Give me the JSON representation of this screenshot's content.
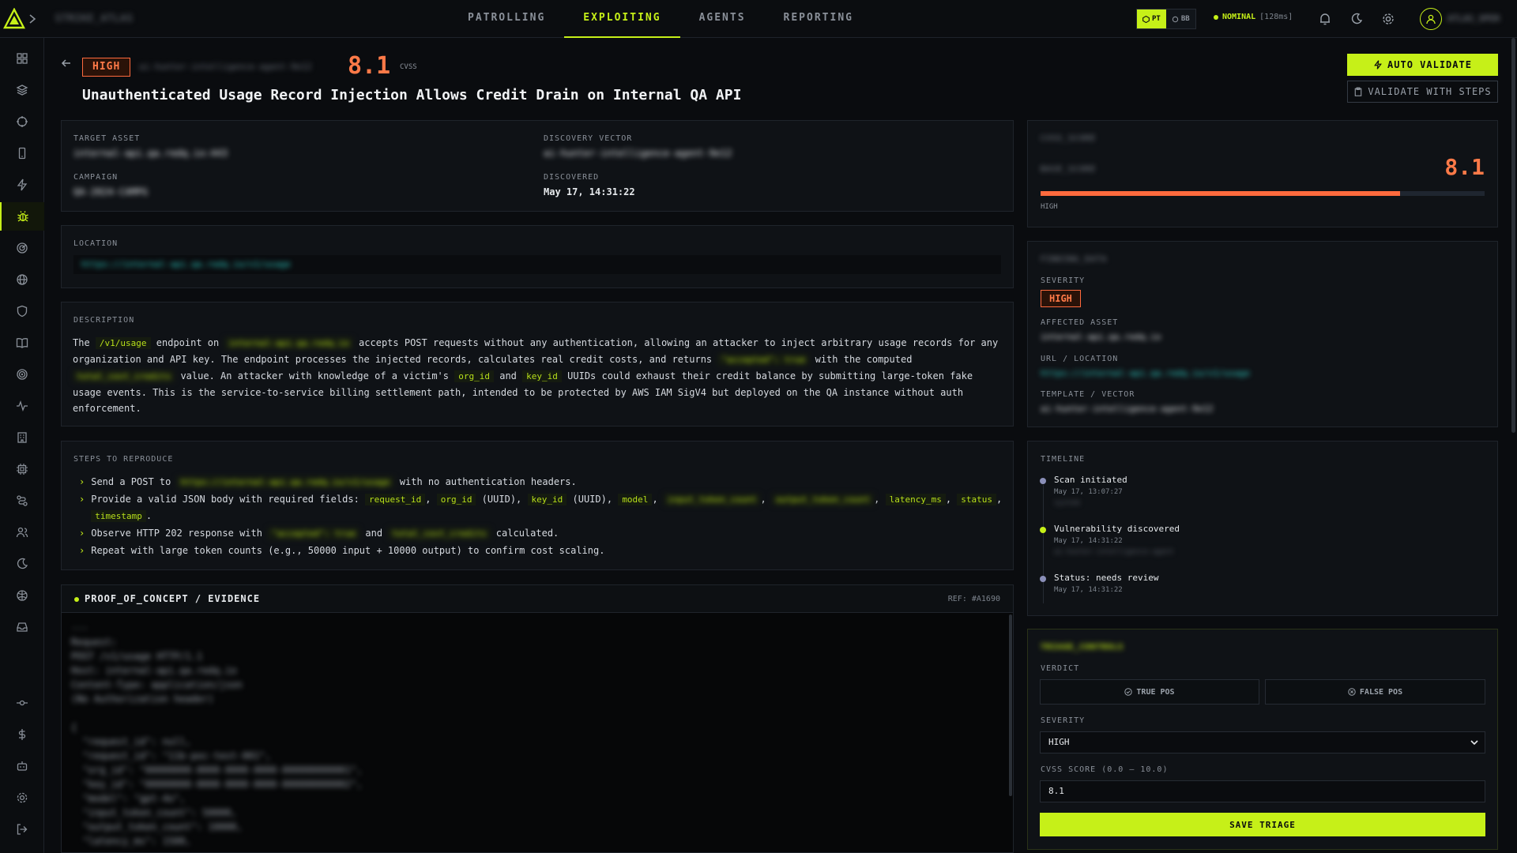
{
  "app": {
    "brand": "STRIKE_ATLAS",
    "user": "ATLAS_OPER"
  },
  "nav": {
    "tabs": [
      {
        "label": "PATROLLING"
      },
      {
        "label": "EXPLOITING"
      },
      {
        "label": "AGENTS"
      },
      {
        "label": "REPORTING"
      }
    ],
    "active": "EXPLOITING"
  },
  "mode": {
    "pt": "PT",
    "bb": "BB"
  },
  "system_status": {
    "label": "NOMINAL",
    "latency": "[128ms]"
  },
  "finding": {
    "severity": "HIGH",
    "id": "ai-hunter-intelligence-agent-9e12",
    "cvss": "8.1",
    "cvss_label": "CVSS",
    "title": "Unauthenticated Usage Record Injection Allows Credit Drain on Internal QA API"
  },
  "actions": {
    "auto_validate": "AUTO VALIDATE",
    "validate_steps": "VALIDATE WITH STEPS"
  },
  "meta": {
    "target_asset_label": "TARGET ASSET",
    "target_asset": "internal-api.qa.redq.io:443",
    "discovery_vector_label": "DISCOVERY VECTOR",
    "discovery_vector": "ai-hunter-intelligence-agent-9e12",
    "campaign_label": "CAMPAIGN",
    "campaign": "QA-2024-CAMPG",
    "discovered_label": "DISCOVERED",
    "discovered": "May 17, 14:31:22"
  },
  "location": {
    "label": "LOCATION",
    "url": "https://internal-api.qa.redq.io/v1/usage"
  },
  "description": {
    "label": "DESCRIPTION",
    "t1": "The",
    "code1": "/v1/usage",
    "t2": "endpoint on",
    "code2": "internal-api.qa.redq.io",
    "t3": "accepts POST requests without any authentication, allowing an attacker to inject arbitrary usage records for any organization and API key. The endpoint processes the injected records, calculates real credit costs, and returns",
    "code3": "\"accepted\": true",
    "t4": "with the computed",
    "code4": "total_cost_credits",
    "t5": "value. An attacker with knowledge of a victim's",
    "code5": "org_id",
    "t6": "and",
    "code6": "key_id",
    "t7": "UUIDs could exhaust their credit balance by submitting large-token fake usage events. This is the service-to-service billing settlement path, intended to be protected by AWS IAM SigV4 but deployed on the QA instance without auth enforcement."
  },
  "steps": {
    "label": "STEPS TO REPRODUCE",
    "s1a": "Send a POST to",
    "s1code": "https://internal-api.qa.redq.io/v1/usage",
    "s1b": "with no authentication headers.",
    "s2a": "Provide a valid JSON body with required fields:",
    "s2c1": "request_id",
    "s2c2": "org_id",
    "s2t1": "(UUID),",
    "s2c3": "key_id",
    "s2t2": "(UUID),",
    "s2c4": "model",
    "s2c5": "input_token_count",
    "s2c6": "output_token_count",
    "s2c7": "latency_ms",
    "s2c8": "status",
    "s2c9": "timestamp",
    "s3a": "Observe HTTP 202 response with",
    "s3code": "\"accepted\": true",
    "s3b": "and",
    "s3code2": "total_cost_credits",
    "s3c": "calculated.",
    "s4": "Repeat with large token counts (e.g., 50000 input + 10000 output) to confirm cost scaling."
  },
  "poc": {
    "title": "PROOF_OF_CONCEPT / EVIDENCE",
    "ref": "REF: #A1690",
    "lines": [
      "---",
      "Request:",
      "POST /v1/usage HTTP/1.1",
      "Host: internal-api.qa.redq.io",
      "Content-Type: application/json",
      "(No Authorization header)",
      "",
      "{",
      "  \"request_id\": null,",
      "  \"request_id\": \"11b-poc-test-001\",",
      "  \"org_id\": \"00000000-0000-0000-0000-000000000001\",",
      "  \"key_id\": \"00000000-0000-0000-0000-000000000002\",",
      "  \"model\": \"gpt-4o\",",
      "  \"input_token_count\": 50000,",
      "  \"output_token_count\": 10000,",
      "  \"latency_ms\": 1500,"
    ]
  },
  "cvss_card": {
    "heading": "CVSS_SCORE",
    "base_label": "BASE_SCORE",
    "score": "8.1",
    "score_pct": 81,
    "severity": "HIGH"
  },
  "finding_data": {
    "heading": "FINDING_DATA",
    "severity_label": "SEVERITY",
    "severity": "HIGH",
    "affected_label": "AFFECTED ASSET",
    "affected": "internal-api.qa.redq.io",
    "url_label": "URL / LOCATION",
    "url": "https://internal-api.qa.redq.io/v1/usage",
    "template_label": "TEMPLATE / VECTOR",
    "template": "ai-hunter-intelligence-agent-9e12"
  },
  "timeline": {
    "label": "TIMELINE",
    "items": [
      {
        "text": "Scan initiated",
        "time": "May 17, 13:07:27",
        "sub": "system",
        "color": "#8a8fb8"
      },
      {
        "text": "Vulnerability discovered",
        "time": "May 17, 14:31:22",
        "sub": "ai-hunter-intelligence-agent",
        "color": "#c6f018"
      },
      {
        "text": "Status: needs review",
        "time": "May 17, 14:31:22",
        "sub": "",
        "color": "#8a8fb8"
      }
    ]
  },
  "triage": {
    "heading": "TRIAGE_CONTROLS",
    "verdict_label": "VERDICT",
    "true_pos": "TRUE POS",
    "false_pos": "FALSE POS",
    "severity_label": "SEVERITY",
    "severity_value": "HIGH",
    "cvss_label": "CVSS SCORE (0.0 – 10.0)",
    "cvss_value": "8.1",
    "save": "SAVE TRIAGE"
  },
  "colors": {
    "accent": "#c6f018",
    "high": "#ff6a3d",
    "bg": "#0a0c0f",
    "panel": "#0f1216"
  }
}
